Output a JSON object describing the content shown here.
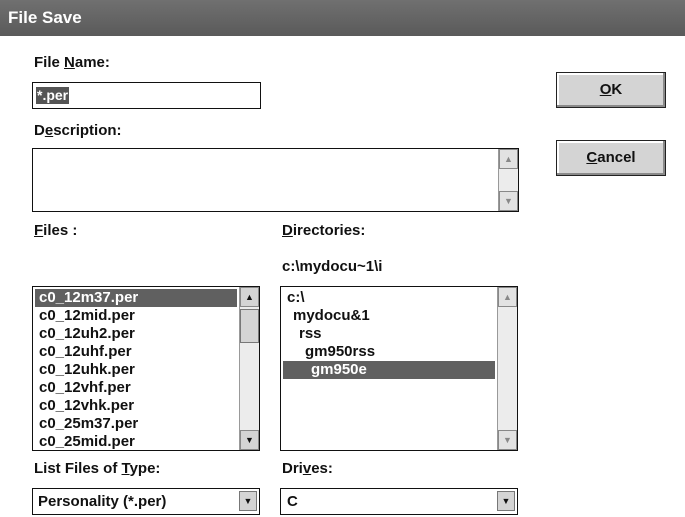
{
  "window": {
    "title": "File Save"
  },
  "filename": {
    "label_pre": "File ",
    "label_u": "N",
    "label_post": "ame:",
    "value": "*.per"
  },
  "description": {
    "label_pre": "D",
    "label_u": "e",
    "label_post": "scription:",
    "value": ""
  },
  "buttons": {
    "ok": {
      "label_u": "O",
      "label_post": "K"
    },
    "cancel": {
      "label_u": "C",
      "label_post": "ancel"
    }
  },
  "files": {
    "label_u": "F",
    "label_post": "iles :",
    "items": [
      "c0_12m37.per",
      "c0_12mid.per",
      "c0_12uh2.per",
      "c0_12uhf.per",
      "c0_12uhk.per",
      "c0_12vhf.per",
      "c0_12vhk.per",
      "c0_25m37.per",
      "c0_25mid.per"
    ],
    "selected_index": 0
  },
  "directories": {
    "label_u": "D",
    "label_post": "irectories:",
    "current_path": "c:\\mydocu~1\\i",
    "items": [
      "c:\\",
      "mydocu&1",
      "rss",
      "gm950rss",
      "gm950e"
    ],
    "selected_index": 4
  },
  "file_type": {
    "label_pre": "List Files of ",
    "label_u": "T",
    "label_post": "ype:",
    "value": "Personality (*.per)"
  },
  "drives": {
    "label_pre": "Dri",
    "label_u": "v",
    "label_post": "es:",
    "value": "C"
  },
  "icons": {
    "scroll_up": "arrow-up-icon",
    "scroll_down": "arrow-down-icon",
    "dropdown": "chevron-down-icon"
  }
}
